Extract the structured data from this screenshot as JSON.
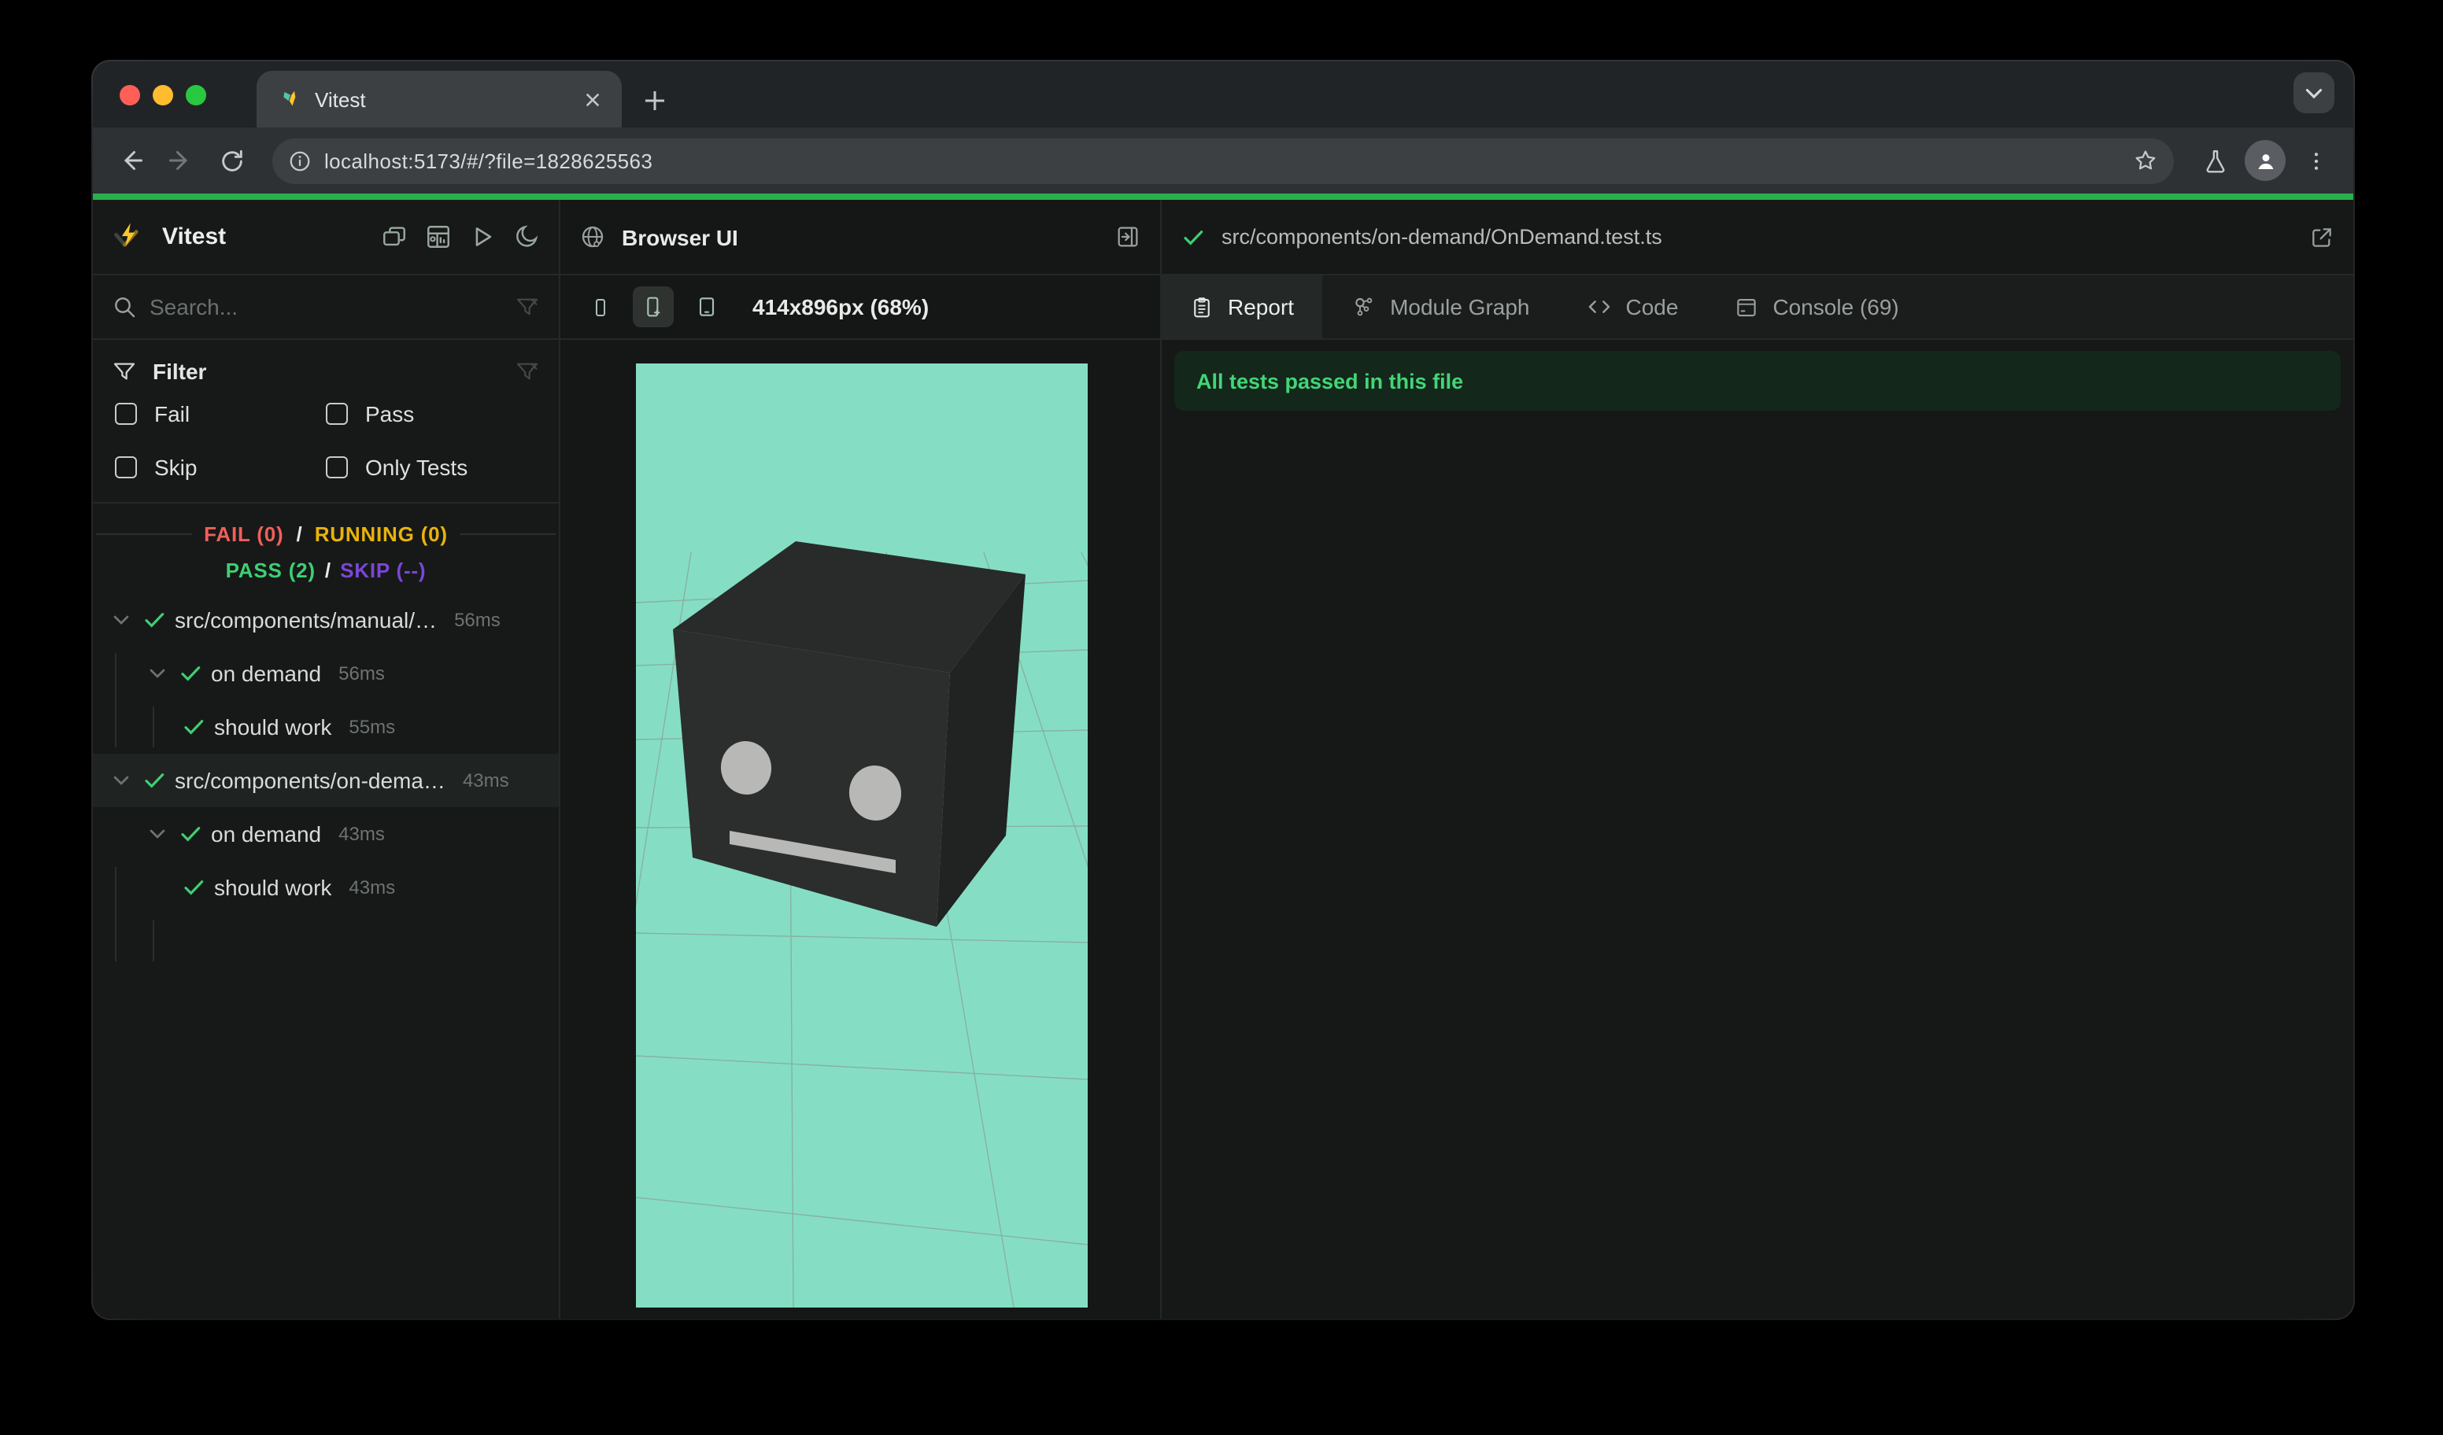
{
  "browser": {
    "tab_title": "Vitest",
    "url": "localhost:5173/#/?file=1828625563"
  },
  "colors": {
    "tl_red": "#ff5f57",
    "tl_yellow": "#febc2e",
    "tl_green": "#28c840",
    "progress_green": "#27b04b",
    "pass_green": "#3ecf72",
    "fail_red": "#f25f5a",
    "running_yellow": "#e9b30b",
    "skip_purple": "#7b46d8",
    "banner_bg": "#13271b",
    "banner_text": "#43d576",
    "mint": "#85dec4",
    "grid_line": "#8a8d85",
    "cube_top": "#282b29",
    "cube_front": "#2b2e2c",
    "cube_right": "#202321",
    "cube_eye": "#b8b9b7"
  },
  "icons": {
    "logo": "vitest-lightning-check",
    "sidebar_header": [
      "dock-windows",
      "dashboard",
      "run-all-play",
      "dark-mode-moon"
    ],
    "search": "magnifier",
    "filter": "funnel",
    "clear_filter": "funnel-x",
    "browser_ui": "globe",
    "expand_panel": "panel-expand-right",
    "devices": [
      "phone-small",
      "phone-plus",
      "tablet"
    ],
    "tabs": [
      "clipboard-report",
      "module-graph-nodes",
      "code-brackets",
      "console-box"
    ],
    "open_external": "external-link"
  },
  "sidebar": {
    "app_name": "Vitest",
    "search_placeholder": "Search...",
    "filter": {
      "title": "Filter",
      "options": [
        {
          "label": "Fail",
          "checked": false
        },
        {
          "label": "Pass",
          "checked": false
        },
        {
          "label": "Skip",
          "checked": false
        },
        {
          "label": "Only Tests",
          "checked": false
        }
      ]
    },
    "summary": {
      "fail": "FAIL (0)",
      "sep1": "/",
      "running": "RUNNING (0)",
      "pass": "PASS (2)",
      "sep2": "/",
      "skip": "SKIP (--)"
    },
    "tree": [
      {
        "label": "src/components/manual/…",
        "duration": "56ms",
        "level": 0,
        "status": "pass",
        "selected": false
      },
      {
        "label": "on demand",
        "duration": "56ms",
        "level": 1,
        "status": "pass",
        "selected": false
      },
      {
        "label": "should work",
        "duration": "55ms",
        "level": 2,
        "status": "pass",
        "selected": false
      },
      {
        "label": "src/components/on-dema…",
        "duration": "43ms",
        "level": 0,
        "status": "pass",
        "selected": true
      },
      {
        "label": "on demand",
        "duration": "43ms",
        "level": 1,
        "status": "pass",
        "selected": false
      },
      {
        "label": "should work",
        "duration": "43ms",
        "level": 2,
        "status": "pass",
        "selected": false
      }
    ]
  },
  "browser_ui": {
    "title": "Browser UI",
    "viewport_label": "414x896px (68%)",
    "active_device": 1
  },
  "report": {
    "file_status": "pass",
    "file_path": "src/components/on-demand/OnDemand.test.ts",
    "tabs": [
      {
        "label": "Report"
      },
      {
        "label": "Module Graph"
      },
      {
        "label": "Code"
      },
      {
        "label": "Console (69)"
      }
    ],
    "active_tab": "Report",
    "banner": "All tests passed in this file"
  }
}
